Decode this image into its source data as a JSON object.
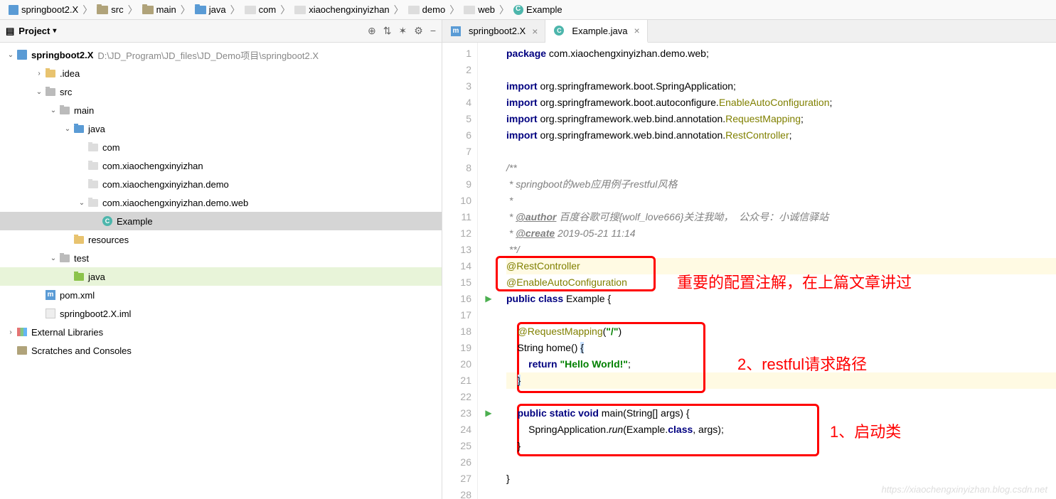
{
  "breadcrumb": [
    {
      "label": "springboot2.X",
      "icon": "proj"
    },
    {
      "label": "src",
      "icon": "folder"
    },
    {
      "label": "main",
      "icon": "folder"
    },
    {
      "label": "java",
      "icon": "folder-blue"
    },
    {
      "label": "com",
      "icon": "pkg"
    },
    {
      "label": "xiaochengxinyizhan",
      "icon": "pkg"
    },
    {
      "label": "demo",
      "icon": "pkg"
    },
    {
      "label": "web",
      "icon": "pkg"
    },
    {
      "label": "Example",
      "icon": "class"
    }
  ],
  "sidebar": {
    "title": "Project",
    "tools": [
      "⊕",
      "⇅",
      "✶",
      "⚙",
      "−"
    ]
  },
  "tree": {
    "root": {
      "label": "springboot2.X",
      "path": "D:\\JD_Program\\JD_files\\JD_Demo项目\\springboot2.X"
    },
    "items": [
      {
        "label": ".idea",
        "indent": 2,
        "arrow": "›",
        "icon": "folder-yellow"
      },
      {
        "label": "src",
        "indent": 2,
        "arrow": "⌄",
        "icon": "folder-grey"
      },
      {
        "label": "main",
        "indent": 3,
        "arrow": "⌄",
        "icon": "folder-grey"
      },
      {
        "label": "java",
        "indent": 4,
        "arrow": "⌄",
        "icon": "folder-blue"
      },
      {
        "label": "com",
        "indent": 5,
        "arrow": "",
        "icon": "pkg"
      },
      {
        "label": "com.xiaochengxinyizhan",
        "indent": 5,
        "arrow": "",
        "icon": "pkg"
      },
      {
        "label": "com.xiaochengxinyizhan.demo",
        "indent": 5,
        "arrow": "",
        "icon": "pkg"
      },
      {
        "label": "com.xiaochengxinyizhan.demo.web",
        "indent": 5,
        "arrow": "⌄",
        "icon": "pkg"
      },
      {
        "label": "Example",
        "indent": 6,
        "arrow": "",
        "icon": "class",
        "selected": true
      },
      {
        "label": "resources",
        "indent": 4,
        "arrow": "",
        "icon": "folder-yellow"
      },
      {
        "label": "test",
        "indent": 3,
        "arrow": "⌄",
        "icon": "folder-grey"
      },
      {
        "label": "java",
        "indent": 4,
        "arrow": "",
        "icon": "folder-green",
        "highlight": true
      },
      {
        "label": "pom.xml",
        "indent": 2,
        "arrow": "",
        "icon": "maven"
      },
      {
        "label": "springboot2.X.iml",
        "indent": 2,
        "arrow": "",
        "icon": "file"
      }
    ],
    "ext_lib": "External Libraries",
    "scratch": "Scratches and Consoles"
  },
  "tabs": [
    {
      "label": "springboot2.X",
      "icon": "maven",
      "active": false
    },
    {
      "label": "Example.java",
      "icon": "class",
      "active": true
    }
  ],
  "code": {
    "lines": [
      {
        "n": 1,
        "html": "<span class='kw'>package</span> com.xiaochengxinyizhan.demo.web;"
      },
      {
        "n": 2,
        "html": ""
      },
      {
        "n": 3,
        "html": "<span class='kw'>import</span> org.springframework.boot.SpringApplication;"
      },
      {
        "n": 4,
        "html": "<span class='kw'>import</span> org.springframework.boot.autoconfigure.<span class='anno'>EnableAutoConfiguration</span>;"
      },
      {
        "n": 5,
        "html": "<span class='kw'>import</span> org.springframework.web.bind.annotation.<span class='anno'>RequestMapping</span>;"
      },
      {
        "n": 6,
        "html": "<span class='kw'>import</span> org.springframework.web.bind.annotation.<span class='anno'>RestController</span>;"
      },
      {
        "n": 7,
        "html": ""
      },
      {
        "n": 8,
        "html": "<span class='cmt'>/**</span>"
      },
      {
        "n": 9,
        "html": "<span class='cmt'> * springboot的web应用例子restful风格</span>"
      },
      {
        "n": 10,
        "html": "<span class='cmt'> *</span>"
      },
      {
        "n": 11,
        "html": "<span class='cmt'> * <span class='cmt-tag'>@author</span> 百度谷歌可搜{wolf_love666}关注我呦，  公众号：小诚信驿站</span>"
      },
      {
        "n": 12,
        "html": "<span class='cmt'> * <span class='cmt-tag'>@create</span> 2019-05-21 11:14</span>"
      },
      {
        "n": 13,
        "html": "<span class='cmt'> **/</span>"
      },
      {
        "n": 14,
        "html": "<span class='anno'>@RestController</span>",
        "hl": true
      },
      {
        "n": 15,
        "html": "<span class='anno'>@EnableAutoConfiguration</span>"
      },
      {
        "n": 16,
        "html": "<span class='kw'>public class</span> Example {",
        "run": true
      },
      {
        "n": 17,
        "html": ""
      },
      {
        "n": 18,
        "html": "    <span class='anno'>@RequestMapping</span>(<span class='str'>\"/\"</span>)"
      },
      {
        "n": 19,
        "html": "    String home() <span class='bracket-hl'>{</span>"
      },
      {
        "n": 20,
        "html": "        <span class='kw'>return</span> <span class='str'>\"Hello World!\"</span>;"
      },
      {
        "n": 21,
        "html": "    <span class='bracket-hl'>}</span>",
        "hl": true
      },
      {
        "n": 22,
        "html": ""
      },
      {
        "n": 23,
        "html": "    <span class='kw'>public static void</span> main(String[] args) {",
        "run": true
      },
      {
        "n": 24,
        "html": "        SpringApplication.<span style='font-style:italic'>run</span>(Example.<span class='kw'>class</span>, args);"
      },
      {
        "n": 25,
        "html": "    }"
      },
      {
        "n": 26,
        "html": ""
      },
      {
        "n": 27,
        "html": "}"
      },
      {
        "n": 28,
        "html": ""
      }
    ]
  },
  "annotations": {
    "text1": "重要的配置注解，在上篇文章讲过",
    "text2": "2、restful请求路径",
    "text3": "1、启动类"
  },
  "watermark": "https://xiaochengxinyizhan.blog.csdn.net"
}
